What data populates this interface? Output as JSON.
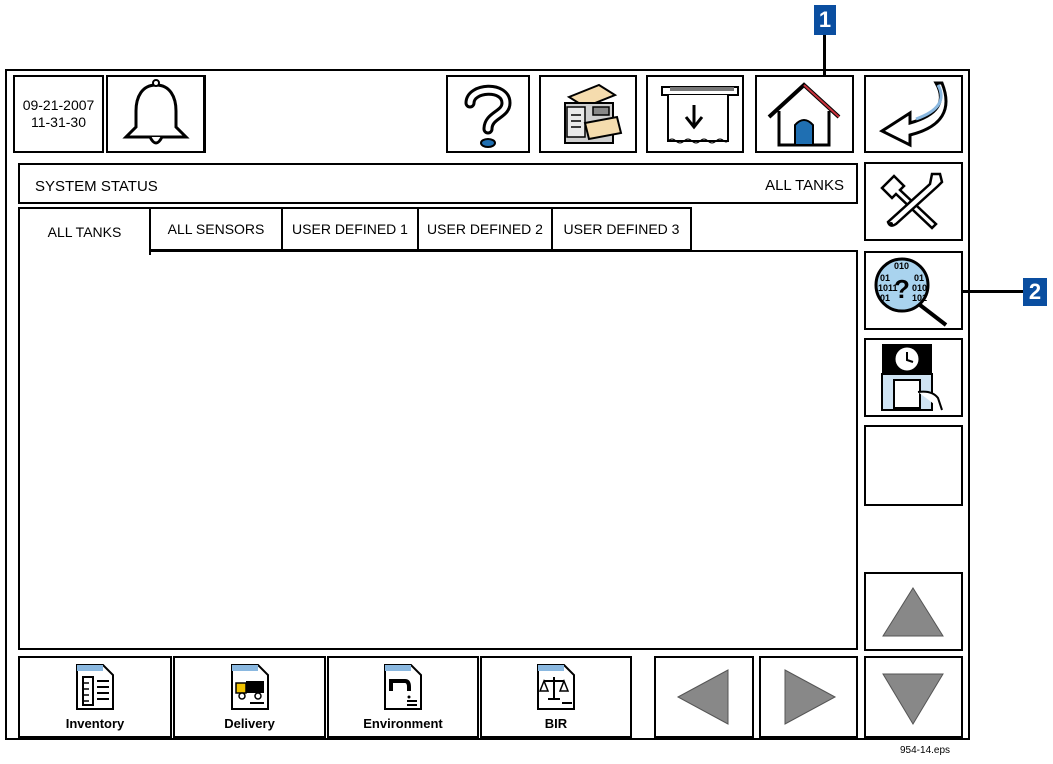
{
  "header": {
    "date": "09-21-2007",
    "time": "11-31-30"
  },
  "status": {
    "title": "SYSTEM STATUS",
    "scope": "ALL TANKS"
  },
  "tabs": [
    {
      "label": "ALL TANKS",
      "active": true
    },
    {
      "label": "ALL SENSORS",
      "active": false
    },
    {
      "label": "USER DEFINED 1",
      "active": false
    },
    {
      "label": "USER DEFINED 2",
      "active": false
    },
    {
      "label": "USER DEFINED 3",
      "active": false
    }
  ],
  "reports": {
    "inventory": "Inventory",
    "delivery": "Delivery",
    "environment": "Environment",
    "bir": "BIR"
  },
  "toolbar_icons": [
    "bell-icon",
    "help-icon",
    "printer-icon",
    "receipt-icon",
    "home-icon",
    "back-arrow-icon"
  ],
  "side_icons": [
    "tools-icon",
    "diagnostics-icon",
    "time-clock-icon",
    "up-arrow-icon",
    "down-arrow-icon"
  ],
  "callouts": {
    "one": "1",
    "two": "2"
  },
  "figure_id": "954-14.eps",
  "colors": {
    "callout": "#0a4ea0",
    "home_roof": "#c8323c",
    "home_door": "#1f6fb2",
    "diag_lens": "#a9d3ee",
    "icon_gray": "#888888"
  }
}
